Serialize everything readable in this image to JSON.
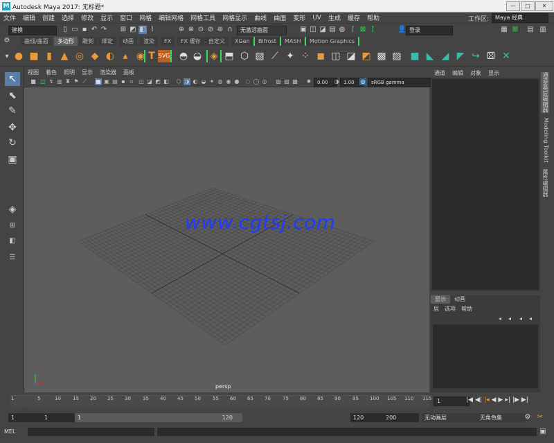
{
  "window": {
    "title": "Autodesk Maya 2017: 无标题*",
    "logo_letter": "M",
    "min_glyph": "—",
    "max_glyph": "□",
    "close_glyph": "✕"
  },
  "menubar": {
    "items": [
      "文件",
      "编辑",
      "创建",
      "选择",
      "修改",
      "显示",
      "窗口",
      "网格",
      "编辑网格",
      "网格工具",
      "网格显示",
      "曲线",
      "曲面",
      "变形",
      "UV",
      "生成",
      "缓存",
      "帮助"
    ],
    "workspace_label": "工作区:",
    "workspace_value": "Maya 经典"
  },
  "statusline": {
    "mode_value": "建模",
    "live_surface": "无激活曲面",
    "login": "登录"
  },
  "shelf": {
    "tabs": [
      "曲线/曲面",
      "多边形",
      "雕刻",
      "绑定",
      "动画",
      "渲染",
      "FX",
      "FX 缓存",
      "自定义",
      "XGen",
      "Bifrost",
      "MASH",
      "Motion Graphics"
    ],
    "active_tab": "多边形",
    "text_tool": "T",
    "svg_tool": "SVG"
  },
  "panel": {
    "menus": [
      "视图",
      "着色",
      "照明",
      "显示",
      "渲染器",
      "面板"
    ],
    "gamma_value_a": "0.00",
    "gamma_value_b": "1.00",
    "color_space": "sRGB gamma",
    "camera_label": "persp",
    "watermark": "www.cgtsj.com"
  },
  "channelbox": {
    "menus": [
      "通道",
      "编辑",
      "对象",
      "显示"
    ]
  },
  "sidetabs": [
    "通道盒/层编辑器",
    "Modeling Toolkit",
    "属性编辑器"
  ],
  "layers": {
    "tabs": [
      "显示",
      "动画"
    ],
    "menus": [
      "层",
      "选项",
      "帮助"
    ]
  },
  "timeline": {
    "ticks": [
      "1",
      "5",
      "10",
      "15",
      "20",
      "25",
      "30",
      "35",
      "40",
      "45",
      "50",
      "55",
      "60",
      "65",
      "70",
      "75",
      "80",
      "85",
      "90",
      "95",
      "100",
      "105",
      "110",
      "115",
      "12"
    ],
    "current_frame": "1"
  },
  "range": {
    "start": "1",
    "start_inner": "1",
    "slider_start": "1",
    "slider_end": "120",
    "end_inner": "120",
    "end": "200",
    "anim_layer": "无动画层",
    "char_set": "无角色集"
  },
  "mel": {
    "label": "MEL"
  },
  "colors": {
    "viewport_bg": "#5d5d5d",
    "ui_bg": "#444444",
    "shelf_icon": "#e89a3c",
    "watermark": "#1e3bff",
    "highlight_green": "#39d95a"
  }
}
